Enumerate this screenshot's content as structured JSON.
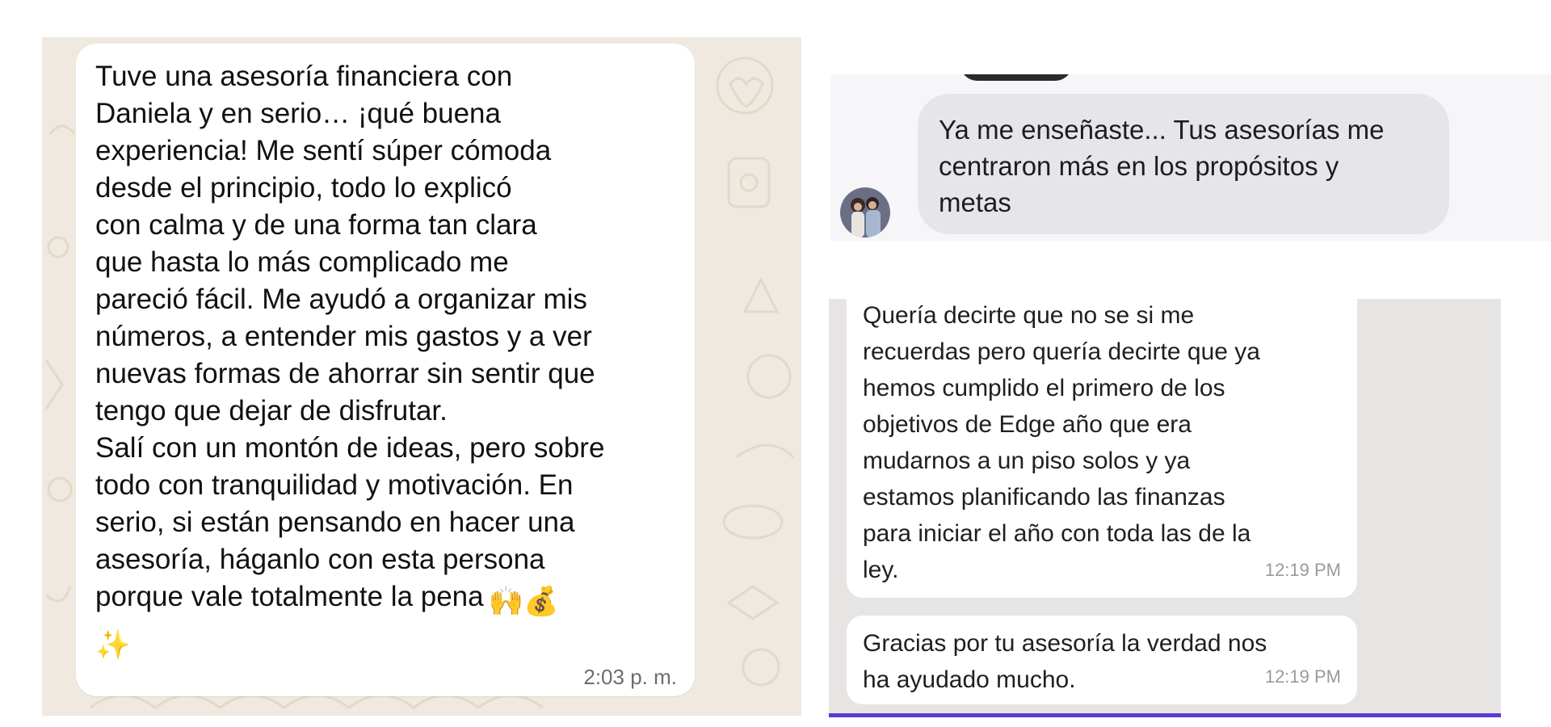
{
  "whatsapp_review": {
    "message_lines": [
      "Tuve una asesoría financiera con",
      "Daniela y en serio… ¡qué buena",
      "experiencia! Me sentí súper cómoda",
      "desde el principio, todo lo explicó",
      "con calma y de una forma tan clara",
      "que hasta lo más complicado me",
      "pareció fácil. Me ayudó a organizar mis",
      "números, a entender mis gastos y a ver",
      "nuevas formas de ahorrar sin sentir que",
      "tengo que dejar de disfrutar.",
      "Salí con un montón de ideas, pero sobre",
      "todo con tranquilidad y motivación. En",
      "serio, si están pensando en hacer una",
      "asesoría, háganlo con esta persona",
      "porque vale totalmente la pena"
    ],
    "emojis": "🙌💰",
    "sparkles": "✨",
    "time": "2:03 p. m."
  },
  "imessage_review": {
    "message": "Ya me enseñaste... Tus asesorías me\ncentraron más en los propósitos y\nmetas"
  },
  "ios_review": {
    "message_1": "Quería decirte que no se si me\nrecuerdas pero quería decirte que ya\nhemos cumplido el primero de los\nobjetivos de Edge año que era\nmudarnos a un piso solos y ya\nestamos planificando las finanzas\npara iniciar el año con toda las de la\nley.",
    "time_1": "12:19 PM",
    "message_2": "Gracias por tu asesoría la verdad nos\nha ayudado mucho.",
    "time_2": "12:19 PM"
  },
  "colors": {
    "whatsapp_wallpaper": "#efe9df",
    "bubble_white": "#ffffff",
    "imessage_bubble": "#e6e6ea",
    "ios_background": "#e7e5e3",
    "accent_purple": "#5b3bd6"
  }
}
